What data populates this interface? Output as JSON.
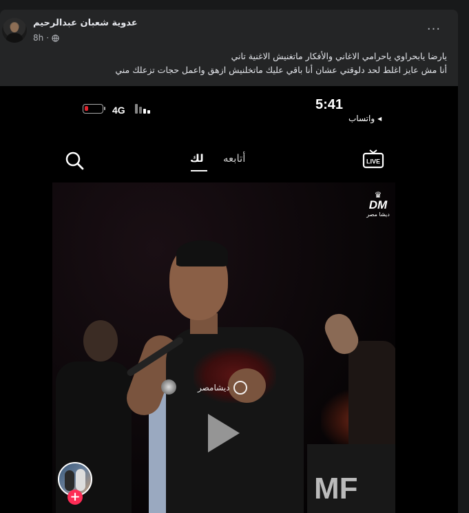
{
  "post": {
    "author": "عدوية شعبان عبدالرحيم",
    "timestamp": "8h",
    "separator": "·",
    "privacy_icon": "globe-icon",
    "more_icon": "more-options-icon",
    "more_label": "···",
    "text_lines": [
      "يارضا يابحراوي ياحرامي الاغاني  والأفكار ماتغنيش الاغنية تاني",
      "أنا مش عايز اغلط لحد دلوقتي  عشان أنا باقي عليك ماتخلنيش ازهق واعمل حجات تزعلك مني"
    ]
  },
  "video": {
    "status_bar": {
      "time": "5:41",
      "carrier": "واتساب",
      "carrier_arrow": "◂",
      "network": "4G",
      "battery_level": 0.2,
      "battery_color": "#e0242e"
    },
    "tabs": {
      "for_you": "لك",
      "following": "أتابعه"
    },
    "watermark": {
      "brand": "DM",
      "brand_sub": "ديشا مصر",
      "center_text": "ديشامصر"
    },
    "stage_sign": "MF",
    "follow_plus": "+",
    "accent_color": "#fe2c55"
  }
}
